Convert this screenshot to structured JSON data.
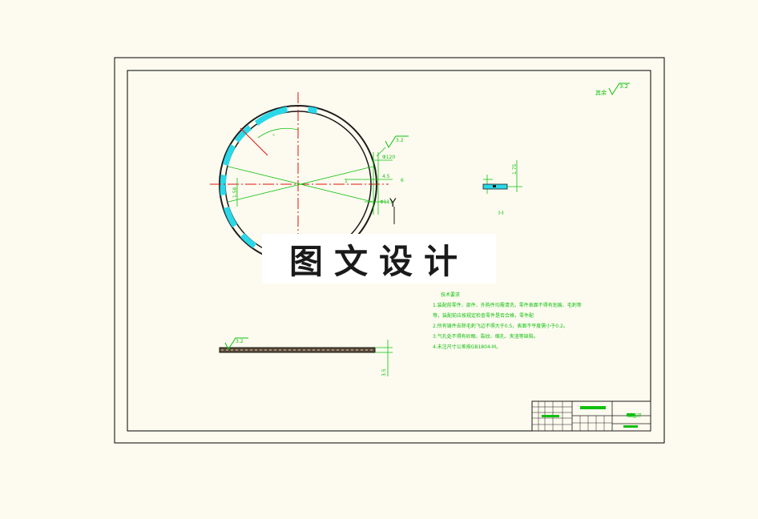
{
  "drawing": {
    "roughness_note": "其余",
    "roughness_value_main": "3.2",
    "roughness_value_tl": "3.2",
    "roughness_value_bl": "3.2",
    "angle_label": "°",
    "dia_outer": "Φ120",
    "dia_inner": "Φ111",
    "dim_width": "4.5",
    "dim_small": "1",
    "dim_6": "6",
    "dim_left": "1.58",
    "section_label": "Y",
    "section_view_label": "Ⅰ-Ⅰ",
    "section_dim": "1.75",
    "thickness_dim": "3.5",
    "tech_title": "技术要求",
    "tech_notes": [
      "1.装配前零件、部件、外购件均需清洗，零件表面不得有划痕、毛刺等",
      "等，装配前应按规定检查零件是否合格，零件配",
      "2.所有铸件去除毛刺飞边不得大于0.5，表面不平度需小于0.2。",
      "3.气孔处不得有砂眼、裂纹、缩孔、夹渣等缺陷。",
      "4.未注尺寸公差按GB1804-M。"
    ]
  },
  "title_block": {
    "part_name": "活塞环",
    "drawing_number": "",
    "material": "",
    "scale": ""
  },
  "watermark": {
    "text": "图文设计"
  },
  "colors": {
    "background": "#fdfbef",
    "frame": "#000000",
    "red": "#e01010",
    "green": "#10c010",
    "cyan": "#2ad8e8",
    "dark": "#1a1a1a"
  }
}
